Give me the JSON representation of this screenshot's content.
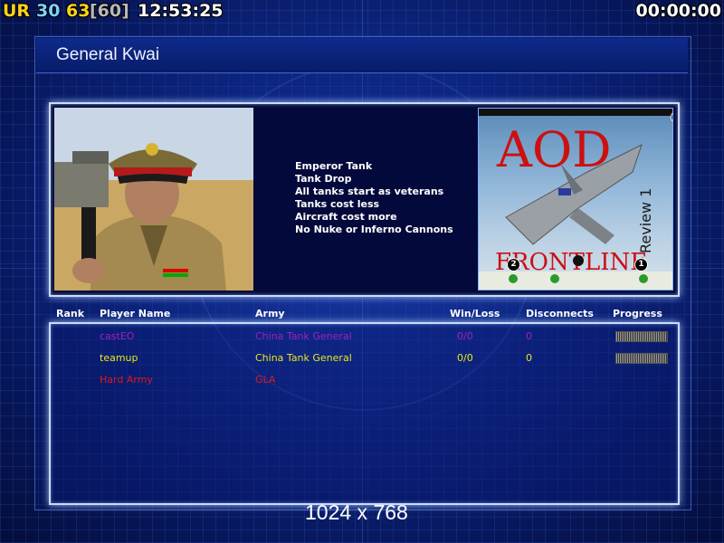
{
  "overlay": {
    "ur_label": "UR",
    "stat_1": "30",
    "stat_2": "63",
    "stat_3": "[60]",
    "clock": "12:53:25",
    "timer": "00:00:00"
  },
  "general": {
    "title": "General Kwai",
    "features": [
      "Emperor Tank",
      "Tank Drop",
      "All tanks start as veterans",
      "Tanks cost less",
      "Aircraft cost more",
      "No Nuke or Inferno Cannons"
    ]
  },
  "map_preview": {
    "title_text": "AOD",
    "subtitle_text": "FRONTLINE",
    "review_text": "Review 1",
    "slot_badges": [
      "4",
      "2",
      "1"
    ]
  },
  "table": {
    "headers": {
      "rank": "Rank",
      "player_name": "Player Name",
      "army": "Army",
      "win_loss": "Win/Loss",
      "disconnects": "Disconnects",
      "progress": "Progress"
    },
    "rows": [
      {
        "player": "castEO",
        "army": "China Tank General",
        "win_loss": "0/0",
        "disconnects": "0",
        "color": "#a020c0",
        "progress": "shown"
      },
      {
        "player": "teamup",
        "army": "China Tank General",
        "win_loss": "0/0",
        "disconnects": "0",
        "color": "#e8e81a",
        "progress": "shown"
      },
      {
        "player": "Hard Army",
        "army": "GLA",
        "win_loss": "",
        "disconnects": "",
        "color": "#e01818",
        "progress": "none"
      }
    ]
  },
  "resolution_label": "1024 x 768",
  "colors": {
    "background": "#0d2680",
    "panel_border": "#c9dcff",
    "overlay_yellow": "#ffd21a",
    "overlay_cyan": "#7fd0ff"
  }
}
